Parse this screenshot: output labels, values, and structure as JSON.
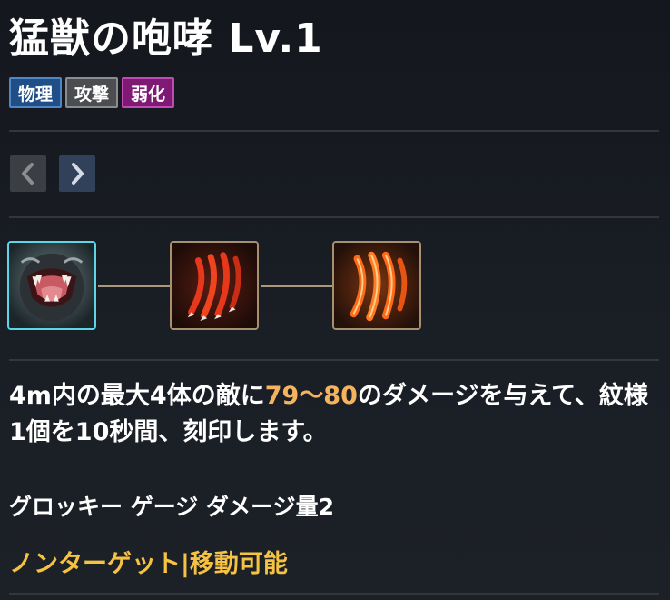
{
  "skill": {
    "title": "猛獣の咆哮 Lv.1"
  },
  "tags": [
    {
      "label": "物理",
      "color": "#1f4f86"
    },
    {
      "label": "攻撃",
      "color": "#4b4d51"
    },
    {
      "label": "弱化",
      "color": "#7e1a73"
    }
  ],
  "nav": {
    "prev_icon": "chevron-left-icon",
    "next_icon": "chevron-right-icon"
  },
  "skill_chain": [
    {
      "icon": "beast-roar-icon",
      "selected": true
    },
    {
      "icon": "claw-slash-icon",
      "selected": false
    },
    {
      "icon": "claw-slash-fire-icon",
      "selected": false
    }
  ],
  "description": {
    "part1": "4m内の最大4体の敵に",
    "damage": "79～80",
    "part2": "のダメージを与えて、紋様1個を10秒間、刻印します。",
    "highlight_color": "#f5b35e"
  },
  "gauge_text": "グロッキー ゲージ ダメージ量2",
  "properties_text": "ノンターゲット|移動可能",
  "properties_color": "#f5c242"
}
